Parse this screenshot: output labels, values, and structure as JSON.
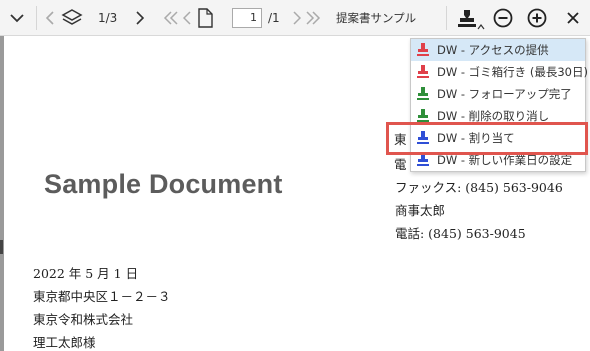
{
  "toolbar": {
    "page_counter": "1/3",
    "page_input_value": "1",
    "page_total": "/1",
    "document_name": "提案書サンプル",
    "icons": [
      "chevron-down-icon",
      "chevron-left-icon",
      "layers-icon",
      "chevron-right-icon",
      "first-page-icon",
      "previous-page-icon",
      "page-icon",
      "next-page-icon",
      "last-page-icon",
      "stamp-icon",
      "caret-up-icon",
      "zoom-out-icon",
      "zoom-in-icon",
      "close-icon"
    ]
  },
  "stamp_menu": {
    "items": [
      {
        "label": "DW - アクセスの提供",
        "color": "#e0404a"
      },
      {
        "label": "DW - ゴミ箱行き (最長30日)",
        "color": "#e0404a"
      },
      {
        "label": "DW - フォローアップ完了",
        "color": "#2f8f3a"
      },
      {
        "label": "DW - 削除の取り消し",
        "color": "#2f8f3a"
      },
      {
        "label": "DW - 割り当て",
        "color": "#2f4fd6"
      },
      {
        "label": "DW - 新しい作業日の設定",
        "color": "#2f4fd6"
      }
    ],
    "highlight_color": "#e0554e",
    "selected_color": "#d6e8f7"
  },
  "document": {
    "title": "Sample Document",
    "right_block": [
      "東",
      "電",
      "ファックス: (845) 563-9046",
      "商事太郎",
      "電話: (845) 563-9045"
    ],
    "left_block": [
      "2022 年 5 月 1 日",
      "東京都中央区１－２－３",
      "東京令和株式会社",
      "理工太郎様"
    ]
  }
}
